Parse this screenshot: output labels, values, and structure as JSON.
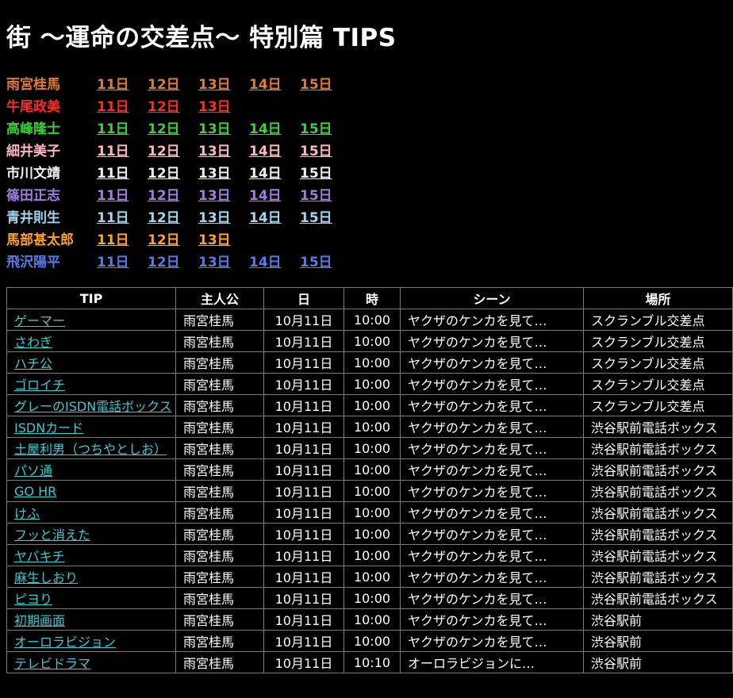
{
  "page": {
    "title": "街 〜運命の交差点〜 特別篇 TIPS"
  },
  "characters": [
    {
      "name": "雨宮桂馬",
      "color": "#e07a3a",
      "days": [
        "11日",
        "12日",
        "13日",
        "14日",
        "15日"
      ]
    },
    {
      "name": "牛尾政美",
      "color": "#ff2a2a",
      "days": [
        "11日",
        "12日",
        "13日"
      ]
    },
    {
      "name": "高峰隆士",
      "color": "#3ccf3c",
      "days": [
        "11日",
        "12日",
        "13日",
        "14日",
        "15日"
      ]
    },
    {
      "name": "細井美子",
      "color": "#ffb6c1",
      "days": [
        "11日",
        "12日",
        "13日",
        "14日",
        "15日"
      ]
    },
    {
      "name": "市川文靖",
      "color": "#f0f0f0",
      "days": [
        "11日",
        "12日",
        "13日",
        "14日",
        "15日"
      ]
    },
    {
      "name": "篠田正志",
      "color": "#a07be0",
      "days": [
        "11日",
        "12日",
        "13日",
        "14日",
        "15日"
      ]
    },
    {
      "name": "青井則生",
      "color": "#9fd5f0",
      "days": [
        "11日",
        "12日",
        "13日",
        "14日",
        "15日"
      ]
    },
    {
      "name": "馬部甚太郎",
      "color": "#ffa030",
      "days": [
        "11日",
        "12日",
        "13日"
      ]
    },
    {
      "name": "飛沢陽平",
      "color": "#5a78e8",
      "days": [
        "11日",
        "12日",
        "13日",
        "14日",
        "15日"
      ]
    }
  ],
  "table": {
    "headers": [
      "TIP",
      "主人公",
      "日",
      "時",
      "シーン",
      "場所"
    ],
    "rows": [
      [
        "ゲーマー",
        "雨宮桂馬",
        "10月11日",
        "10:00",
        "ヤクザのケンカを見て…",
        "スクランブル交差点"
      ],
      [
        "さわぎ",
        "雨宮桂馬",
        "10月11日",
        "10:00",
        "ヤクザのケンカを見て…",
        "スクランブル交差点"
      ],
      [
        "ハチ公",
        "雨宮桂馬",
        "10月11日",
        "10:00",
        "ヤクザのケンカを見て…",
        "スクランブル交差点"
      ],
      [
        "ゴロイチ",
        "雨宮桂馬",
        "10月11日",
        "10:00",
        "ヤクザのケンカを見て…",
        "スクランブル交差点"
      ],
      [
        "グレーのISDN電話ボックス",
        "雨宮桂馬",
        "10月11日",
        "10:00",
        "ヤクザのケンカを見て…",
        "スクランブル交差点"
      ],
      [
        "ISDNカード",
        "雨宮桂馬",
        "10月11日",
        "10:00",
        "ヤクザのケンカを見て…",
        "渋谷駅前電話ボックス"
      ],
      [
        "土屋利男（つちやとしお）",
        "雨宮桂馬",
        "10月11日",
        "10:00",
        "ヤクザのケンカを見て…",
        "渋谷駅前電話ボックス"
      ],
      [
        "パソ通",
        "雨宮桂馬",
        "10月11日",
        "10:00",
        "ヤクザのケンカを見て…",
        "渋谷駅前電話ボックス"
      ],
      [
        "GO HR",
        "雨宮桂馬",
        "10月11日",
        "10:00",
        "ヤクザのケンカを見て…",
        "渋谷駅前電話ボックス"
      ],
      [
        "けふ",
        "雨宮桂馬",
        "10月11日",
        "10:00",
        "ヤクザのケンカを見て…",
        "渋谷駅前電話ボックス"
      ],
      [
        "フッと消えた",
        "雨宮桂馬",
        "10月11日",
        "10:00",
        "ヤクザのケンカを見て…",
        "渋谷駅前電話ボックス"
      ],
      [
        "ヤバキチ",
        "雨宮桂馬",
        "10月11日",
        "10:00",
        "ヤクザのケンカを見て…",
        "渋谷駅前電話ボックス"
      ],
      [
        "麻生しおり",
        "雨宮桂馬",
        "10月11日",
        "10:00",
        "ヤクザのケンカを見て…",
        "渋谷駅前電話ボックス"
      ],
      [
        "ピヨり",
        "雨宮桂馬",
        "10月11日",
        "10:00",
        "ヤクザのケンカを見て…",
        "渋谷駅前電話ボックス"
      ],
      [
        "初期画面",
        "雨宮桂馬",
        "10月11日",
        "10:00",
        "ヤクザのケンカを見て…",
        "渋谷駅前"
      ],
      [
        "オーロラビジョン",
        "雨宮桂馬",
        "10月11日",
        "10:00",
        "ヤクザのケンカを見て…",
        "渋谷駅前"
      ],
      [
        "テレビドラマ",
        "雨宮桂馬",
        "10月11日",
        "10:10",
        "オーロラビジョンに…",
        "渋谷駅前"
      ]
    ]
  }
}
